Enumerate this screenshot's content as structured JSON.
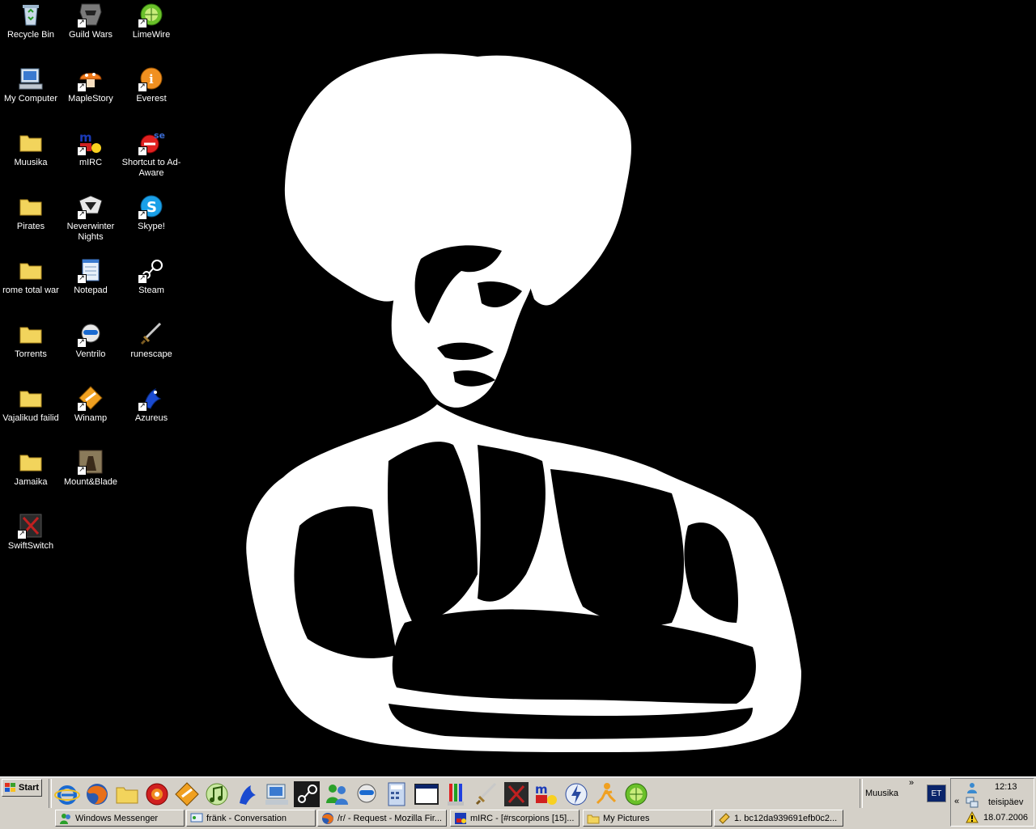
{
  "desktop": {
    "icons_col1": [
      {
        "label": "Recycle Bin",
        "icon": "recycle-bin-icon"
      },
      {
        "label": "My Computer",
        "icon": "my-computer-icon"
      },
      {
        "label": "Muusika",
        "icon": "folder-icon"
      },
      {
        "label": "Pirates",
        "icon": "folder-icon"
      },
      {
        "label": "rome total war",
        "icon": "folder-icon"
      },
      {
        "label": "Torrents",
        "icon": "folder-icon"
      },
      {
        "label": "Vajalikud failid",
        "icon": "folder-icon"
      },
      {
        "label": "Jamaika",
        "icon": "folder-icon"
      },
      {
        "label": "SwiftSwitch",
        "icon": "swiftswitch-icon"
      }
    ],
    "icons_col2": [
      {
        "label": "Guild Wars",
        "icon": "guild-wars-icon"
      },
      {
        "label": "MapleStory",
        "icon": "maplestory-icon"
      },
      {
        "label": "mIRC",
        "icon": "mirc-icon"
      },
      {
        "label": "Neverwinter Nights",
        "icon": "neverwinter-nights-icon"
      },
      {
        "label": "Notepad",
        "icon": "notepad-icon"
      },
      {
        "label": "Ventrilo",
        "icon": "ventrilo-icon"
      },
      {
        "label": "Winamp",
        "icon": "winamp-icon"
      },
      {
        "label": "Mount&Blade",
        "icon": "mount-blade-icon"
      }
    ],
    "icons_col3": [
      {
        "label": "LimeWire",
        "icon": "limewire-icon"
      },
      {
        "label": "Everest",
        "icon": "everest-icon"
      },
      {
        "label": "Shortcut to Ad-Aware",
        "icon": "ad-aware-icon"
      },
      {
        "label": "Skype!",
        "icon": "skype-icon"
      },
      {
        "label": "Steam",
        "icon": "steam-icon"
      },
      {
        "label": "runescape",
        "icon": "runescape-icon"
      },
      {
        "label": "Azureus",
        "icon": "azureus-icon"
      }
    ]
  },
  "taskbar": {
    "start_label": "Start",
    "quick_launch": [
      "internet-explorer-icon",
      "firefox-icon",
      "folder-icon",
      "burn-icon",
      "winamp-icon",
      "itunes-icon",
      "azureus-icon",
      "my-computer-icon",
      "steam-icon",
      "messenger-icon",
      "ventrilo-icon",
      "calculator-icon",
      "window-icon",
      "paint-icon",
      "runescape-icon",
      "swiftswitch-icon",
      "mirc-icon",
      "lightning-icon",
      "aim-icon",
      "limewire-icon"
    ],
    "toolbar_label": "Muusika",
    "language": "ET",
    "tasks": [
      {
        "label": "Windows Messenger",
        "icon": "messenger-icon"
      },
      {
        "label": "fränk - Conversation",
        "icon": "conversation-icon"
      },
      {
        "label": "/r/ - Request - Mozilla Fir...",
        "icon": "firefox-icon"
      },
      {
        "label": "mIRC - [#rscorpions [15]...",
        "icon": "mirc-icon"
      },
      {
        "label": "My Pictures",
        "icon": "folder-icon"
      },
      {
        "label": "1. bc12da939691efb0c2...",
        "icon": "ticket-icon"
      }
    ],
    "tray": {
      "time": "12:13",
      "day": "teisipäev",
      "date": "18.07.2006",
      "expand_chevron": "«"
    }
  },
  "colors": {
    "desktop_bg": "#000000",
    "taskbar_bg": "#d4d0c8",
    "folder_yellow": "#f2d45c"
  }
}
